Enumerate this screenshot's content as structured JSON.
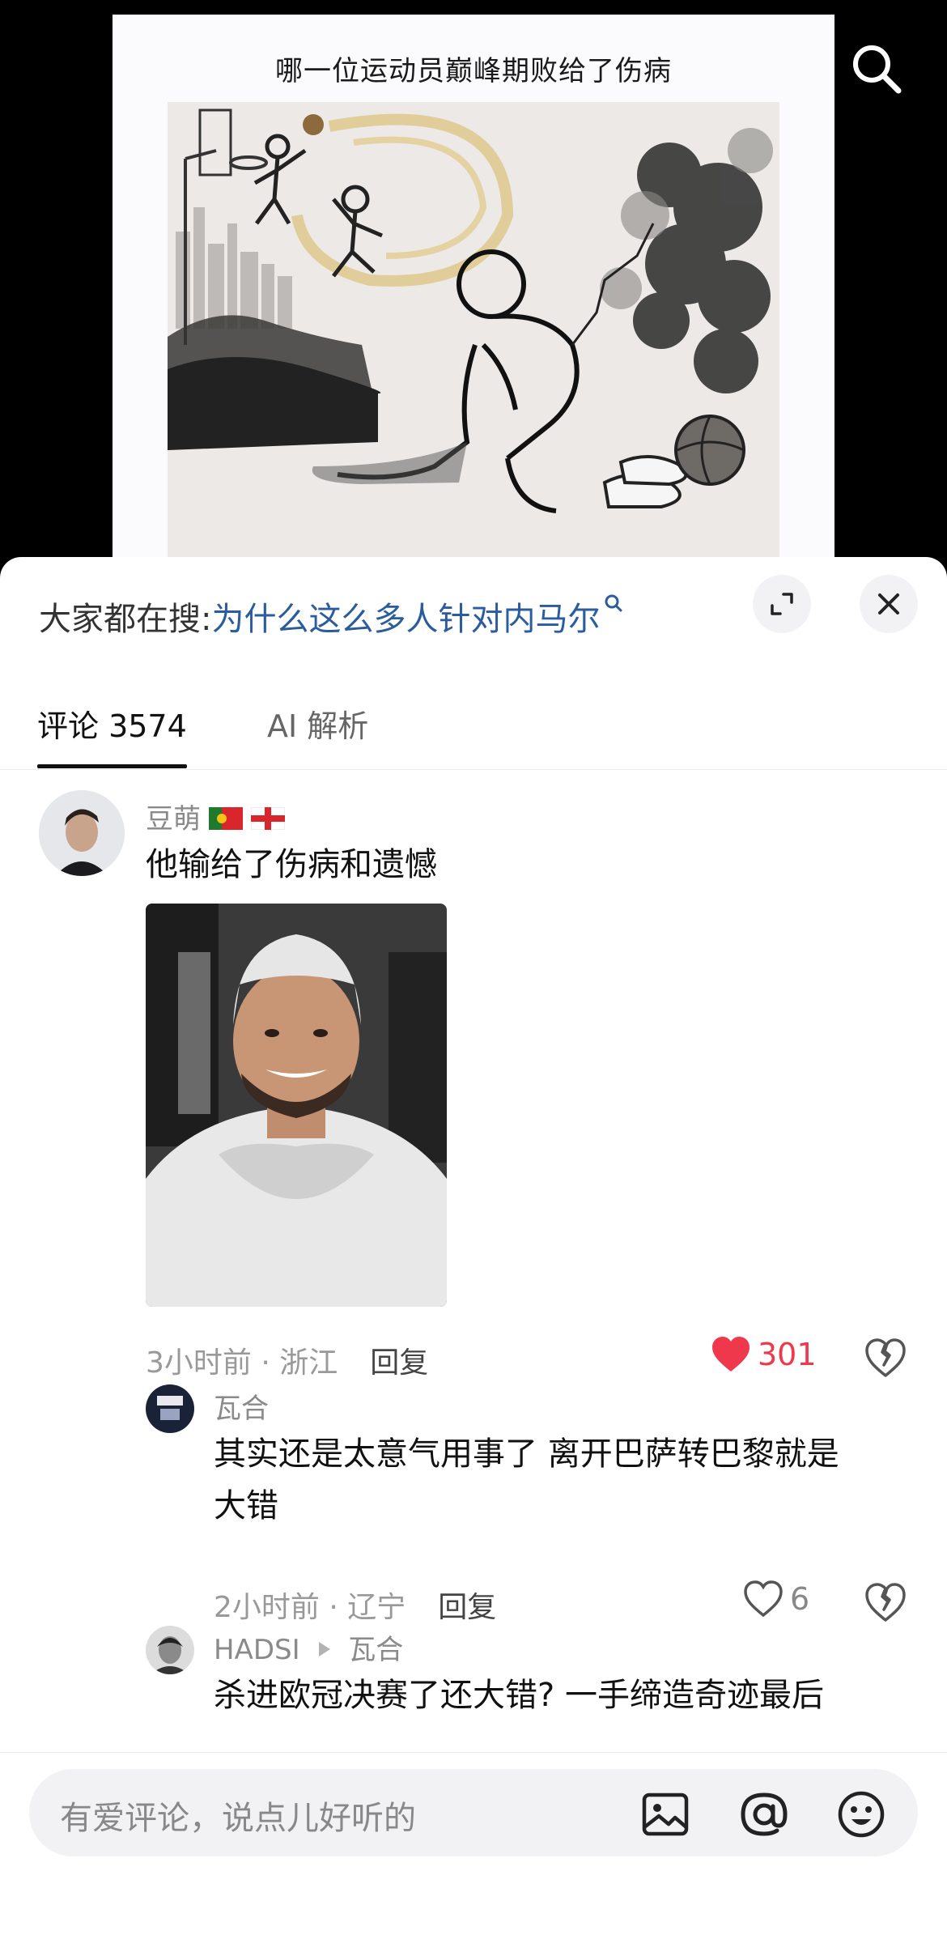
{
  "video": {
    "poster_title": "哪一位运动员巅峰期败给了伤病"
  },
  "sheet": {
    "hot_search_prefix": "大家都在搜:",
    "hot_search_query": "为什么这么多人针对内马尔"
  },
  "tabs": [
    {
      "label": "评论 3574",
      "active": true
    },
    {
      "label": "AI 解析",
      "active": false
    }
  ],
  "comments": [
    {
      "user": "豆萌",
      "flags": [
        "portugal-flag",
        "england-flag"
      ],
      "text": "他输给了伤病和遗憾",
      "time_location": "3小时前 · 浙江",
      "reply_label": "回复",
      "likes": "301",
      "liked": true,
      "replies": [
        {
          "user": "瓦合",
          "text_line1": "其实还是太意气用事了 离开巴萨转巴黎就是",
          "text_line2": "大错",
          "time_location": "2小时前 · 辽宁",
          "reply_label": "回复",
          "likes": "6"
        },
        {
          "user": "HADSI",
          "reply_to": "瓦合",
          "text_line1": "杀进欧冠决赛了还大错? 一手缔造奇迹最后"
        }
      ]
    }
  ],
  "composer": {
    "placeholder": "有爱评论，说点儿好听的"
  },
  "colors": {
    "like_red": "#f0384c",
    "link_blue": "#2b5c9e"
  }
}
